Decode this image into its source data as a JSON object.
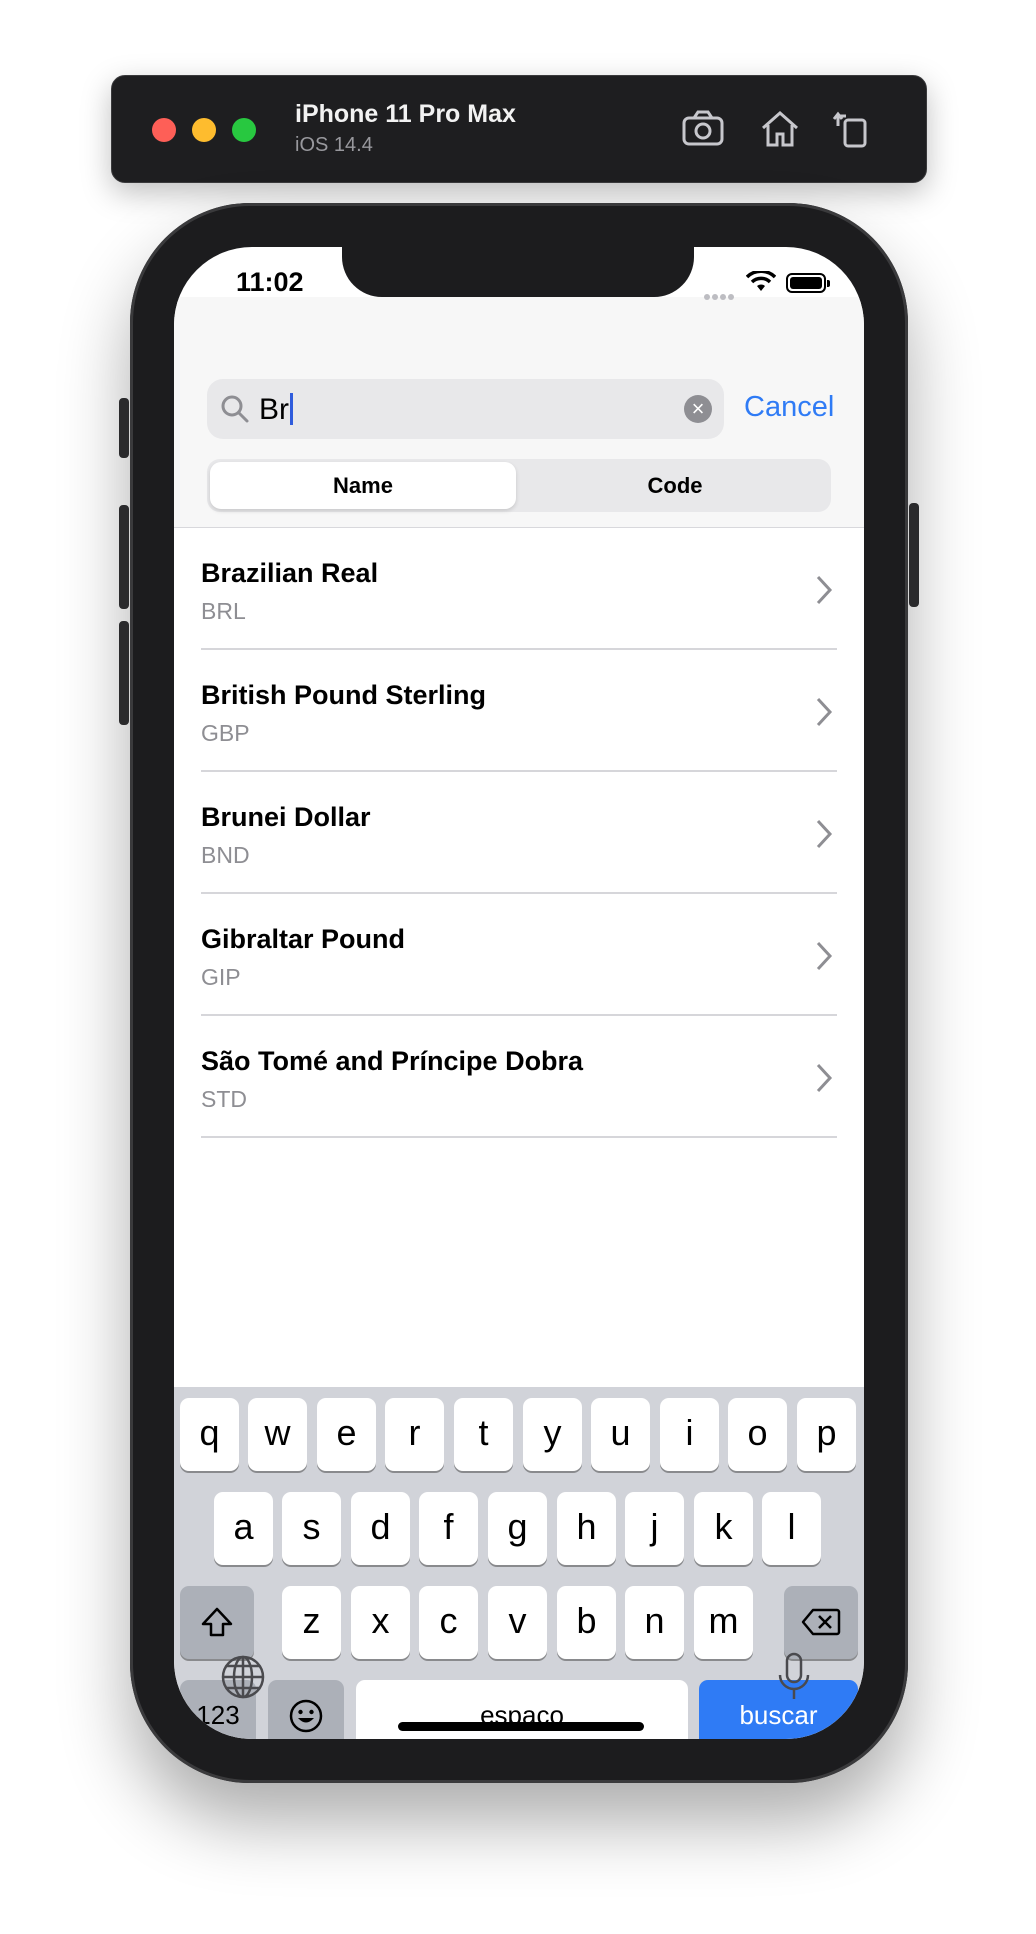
{
  "simulator": {
    "device_name": "iPhone 11 Pro Max",
    "os_version": "iOS 14.4"
  },
  "status_bar": {
    "time": "11:02"
  },
  "search": {
    "query": "Br",
    "cancel_label": "Cancel"
  },
  "segments": {
    "name": "Name",
    "code": "Code"
  },
  "currencies": [
    {
      "name": "Brazilian Real",
      "code": "BRL"
    },
    {
      "name": "British Pound Sterling",
      "code": "GBP"
    },
    {
      "name": "Brunei Dollar",
      "code": "BND"
    },
    {
      "name": "Gibraltar Pound",
      "code": "GIP"
    },
    {
      "name": "São Tomé and Príncipe Dobra",
      "code": "STD"
    }
  ],
  "keyboard": {
    "row1": [
      "q",
      "w",
      "e",
      "r",
      "t",
      "y",
      "u",
      "i",
      "o",
      "p"
    ],
    "row2": [
      "a",
      "s",
      "d",
      "f",
      "g",
      "h",
      "j",
      "k",
      "l"
    ],
    "row3": [
      "z",
      "x",
      "c",
      "v",
      "b",
      "n",
      "m"
    ],
    "numbers_label": "123",
    "space_label": "espaço",
    "search_label": "buscar"
  },
  "colors": {
    "accent": "#2f7bf5",
    "keyboard_bg": "#d1d3d9"
  }
}
